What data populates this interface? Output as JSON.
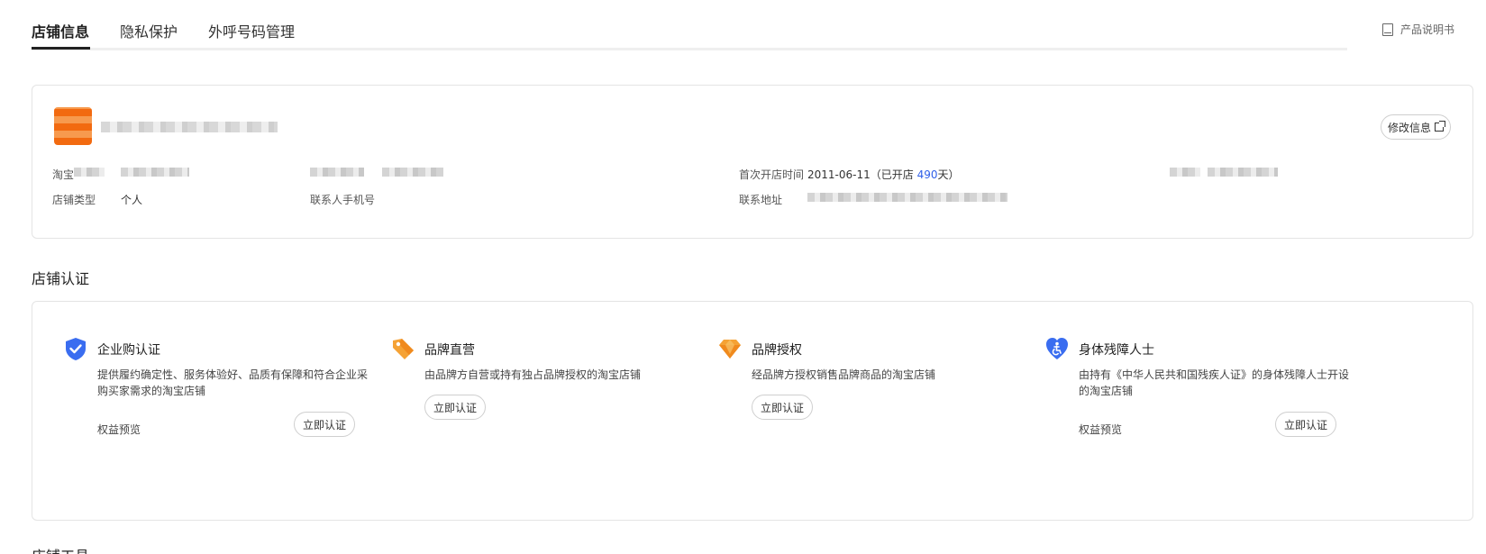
{
  "tabs": [
    {
      "label": "店铺信息",
      "active": true
    },
    {
      "label": "隐私保护",
      "active": false
    },
    {
      "label": "外呼号码管理",
      "active": false
    }
  ],
  "manual": {
    "label": "产品说明书",
    "icon": "book-icon"
  },
  "shop": {
    "edit_label": "修改信息",
    "fields": {
      "taobao_label": "淘宝",
      "first_open_label": "首次开店时间",
      "first_open_date": "2011-06-11",
      "open_prefix": "（已开店 ",
      "open_days": "490",
      "open_suffix": "天）",
      "type_label": "店铺类型",
      "type_value": "个人",
      "phone_label": "联系人手机号",
      "address_label": "联系地址"
    }
  },
  "certification": {
    "title": "店铺认证",
    "items": [
      {
        "title": "企业购认证",
        "icon": "shield-check-icon",
        "desc": "提供履约确定性、服务体验好、品质有保障和符合企业采购买家需求的淘宝店铺",
        "benefit": "权益预览",
        "button": "立即认证"
      },
      {
        "title": "品牌直营",
        "icon": "tag-icon",
        "desc": "由品牌方自营或持有独占品牌授权的淘宝店铺",
        "benefit": "",
        "button": "立即认证"
      },
      {
        "title": "品牌授权",
        "icon": "diamond-icon",
        "desc": "经品牌方授权销售品牌商品的淘宝店铺",
        "benefit": "",
        "button": "立即认证"
      },
      {
        "title": "身体残障人士",
        "icon": "heart-accessibility-icon",
        "desc": "由持有《中华人民共和国残疾人证》的身体残障人士开设的淘宝店铺",
        "benefit": "权益预览",
        "button": "立即认证"
      }
    ]
  },
  "next_section_title": "店铺工具",
  "colors": {
    "accent_blue": "#2f5fe8",
    "brand_orange": "#f26a10"
  }
}
